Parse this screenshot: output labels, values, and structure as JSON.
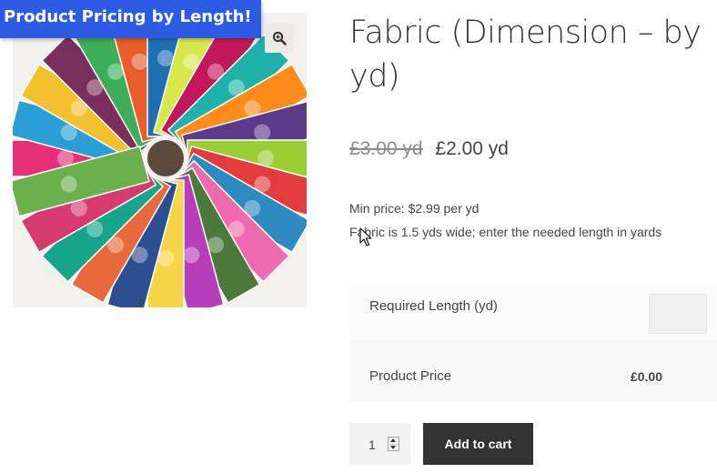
{
  "banner": {
    "text": "Product Pricing by Length!"
  },
  "product": {
    "image_alt": "fabric-fan-image",
    "title": "Fabric (Dimension – by yd)",
    "old_price": "£3.00 yd",
    "price": "£2.00 yd",
    "min_price": "Min price: $2.99 per yd",
    "width_note": "Fabric is 1.5 yds wide; enter the needed length in yards"
  },
  "measurement": {
    "length_label": "Required Length (yd)",
    "length_value": "",
    "product_price_label": "Product Price",
    "product_price_value": "£0.00"
  },
  "cart": {
    "quantity": "1",
    "add_to_cart_label": "Add to cart"
  },
  "colors": {
    "banner": "#2d5be3",
    "button": "#333333"
  },
  "icons": [
    "zoom-icon",
    "cursor-icon",
    "spinner-up-icon",
    "spinner-down-icon"
  ]
}
